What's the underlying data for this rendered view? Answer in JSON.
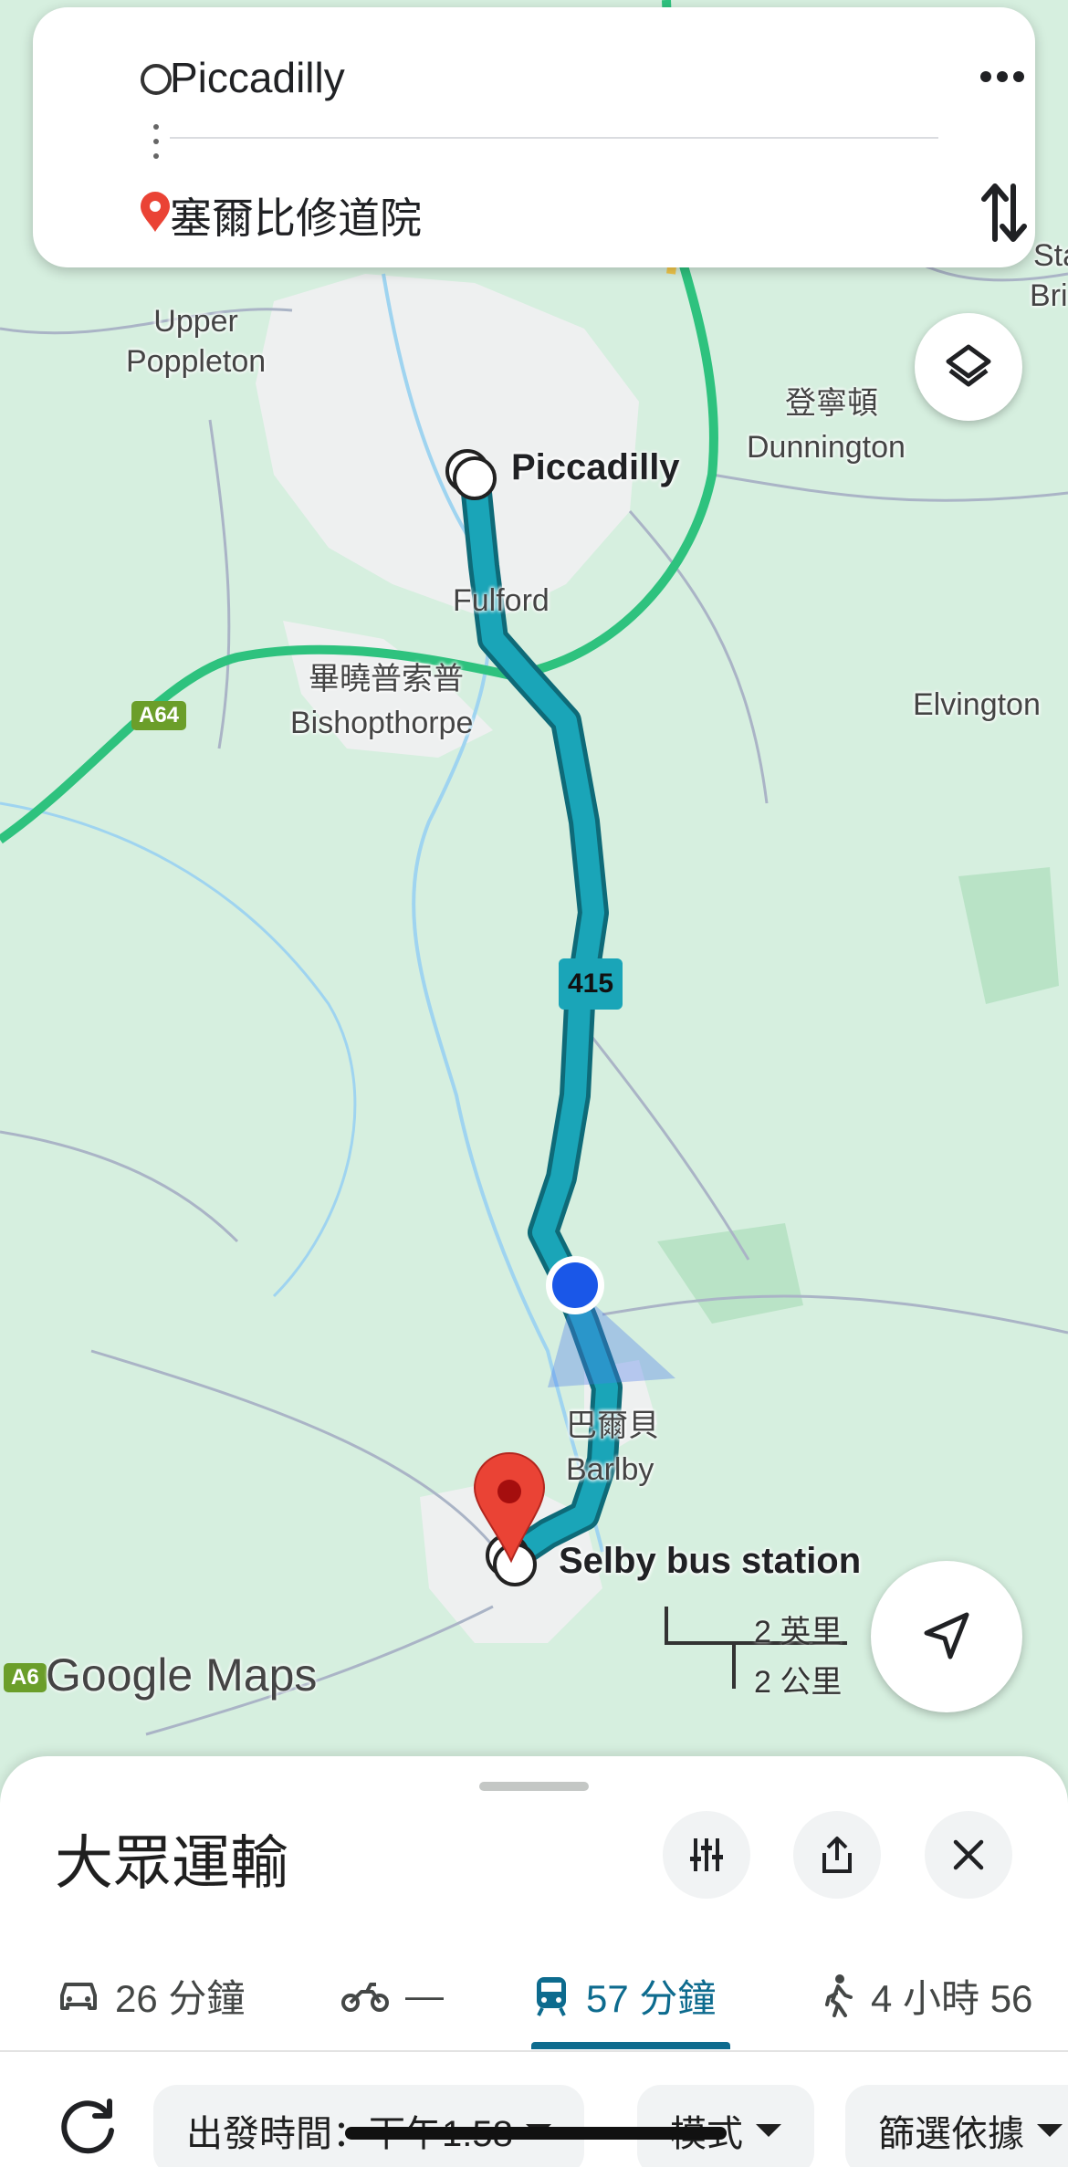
{
  "search": {
    "origin": "Piccadilly",
    "destination": "塞爾比修道院",
    "more_icon": "more-horizontal-icon",
    "swap_icon": "swap-vertical-icon"
  },
  "map": {
    "labels": {
      "upper_poppleton": "Upper\nPoppleton",
      "dunnington_cn": "登寧頓",
      "dunnington": "Dunnington",
      "fulford": "Fulford",
      "bishopthorpe_cn": "畢曉普索普",
      "bishopthorpe": "Bishopthorpe",
      "elvington": "Elvington",
      "barlby_cn": "巴爾貝",
      "barlby": "Barlby",
      "stamford_partial": "Stan",
      "bri_partial": "Bri"
    },
    "origin_stop": "Piccadilly",
    "destination_stop": "Selby bus station",
    "route_number": "415",
    "road_a64": "A64",
    "road_a6": "A6",
    "scale_miles": "2 英里",
    "scale_km": "2 公里",
    "logo": "Google Maps",
    "route_color": "#1aa5b8",
    "road_color": "#2ec27e"
  },
  "sheet": {
    "title": "大眾運輸",
    "filter_icon": "tune-icon",
    "share_icon": "share-icon",
    "close_icon": "close-icon"
  },
  "modes": [
    {
      "icon": "car-icon",
      "label": "26 分鐘"
    },
    {
      "icon": "motorcycle-icon",
      "label": "—"
    },
    {
      "icon": "transit-icon",
      "label": "57 分鐘",
      "active": true
    },
    {
      "icon": "walk-icon",
      "label": "4 小時 56"
    }
  ],
  "controls": {
    "refresh_icon": "refresh-icon",
    "depart_chip": "出發時間：下午1:58",
    "mode_chip": "模式",
    "filter_chip": "篩選依據"
  },
  "colors": {
    "accent": "#0d6b8e",
    "map_bg": "#d6efdf",
    "current_location": "#1a57e8",
    "pin_red": "#ea4335"
  }
}
